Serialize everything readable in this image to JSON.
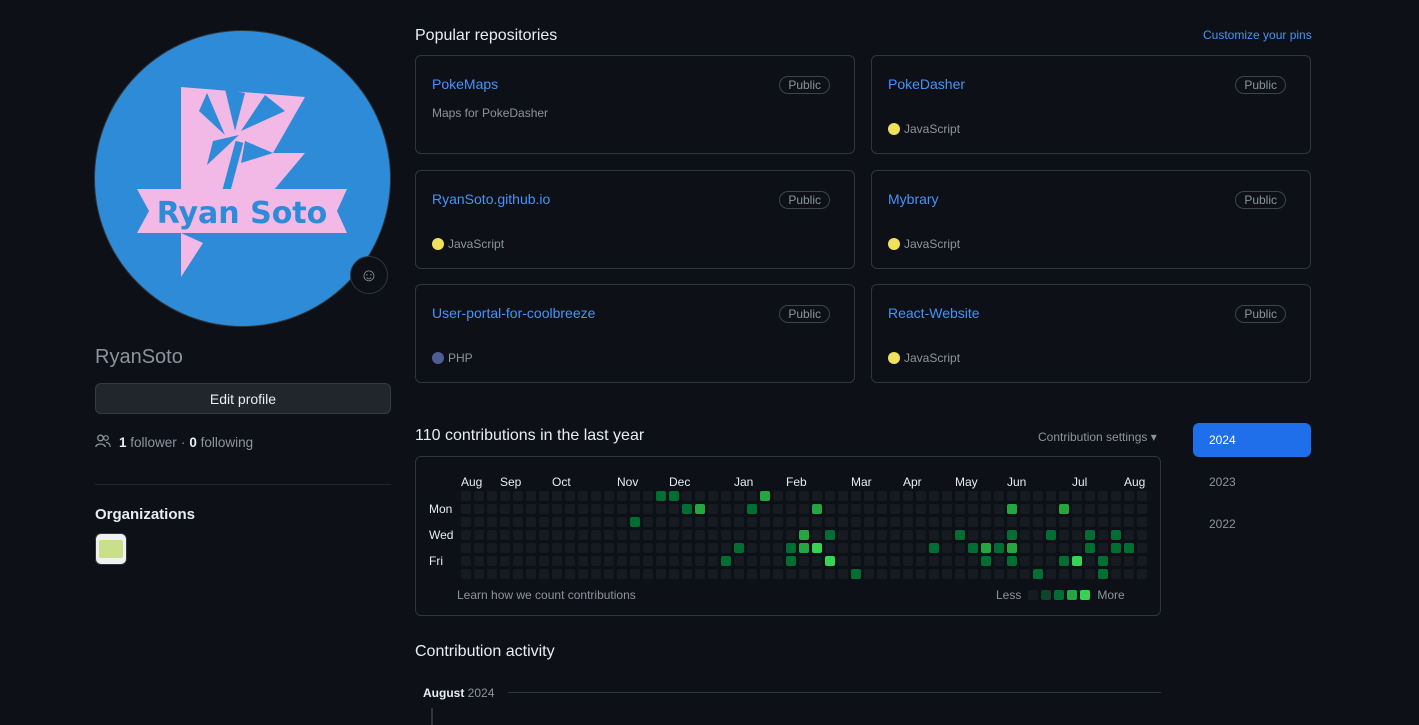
{
  "profile": {
    "avatar_text": "Ryan Soto",
    "username": "RyanSoto",
    "edit_label": "Edit profile",
    "followers_count": "1",
    "followers_label": "follower",
    "following_count": "0",
    "following_label": "following",
    "separator": "·"
  },
  "organizations": {
    "heading": "Organizations"
  },
  "pinned": {
    "title": "Popular repositories",
    "customize_label": "Customize your pins",
    "repos": [
      {
        "name": "PokeMaps",
        "visibility": "Public",
        "description": "Maps for PokeDasher",
        "language": "",
        "lang_color": ""
      },
      {
        "name": "PokeDasher",
        "visibility": "Public",
        "description": "",
        "language": "JavaScript",
        "lang_color": "#f1e05a"
      },
      {
        "name": "RyanSoto.github.io",
        "visibility": "Public",
        "description": "",
        "language": "JavaScript",
        "lang_color": "#f1e05a"
      },
      {
        "name": "Mybrary",
        "visibility": "Public",
        "description": "",
        "language": "JavaScript",
        "lang_color": "#f1e05a"
      },
      {
        "name": "User-portal-for-coolbreeze",
        "visibility": "Public",
        "description": "",
        "language": "PHP",
        "lang_color": "#4F5D95"
      },
      {
        "name": "React-Website",
        "visibility": "Public",
        "description": "",
        "language": "JavaScript",
        "lang_color": "#f1e05a"
      }
    ]
  },
  "contributions": {
    "title": "110 contributions in the last year",
    "settings_label": "Contribution settings ▾",
    "months": [
      "Aug",
      "Sep",
      "Oct",
      "Nov",
      "Dec",
      "Jan",
      "Feb",
      "Mar",
      "Apr",
      "May",
      "Jun",
      "Jul",
      "Aug"
    ],
    "days": [
      "Mon",
      "Wed",
      "Fri"
    ],
    "learn_label": "Learn how we count contributions",
    "less_label": "Less",
    "more_label": "More",
    "colors": [
      "#161b22",
      "#0e4429",
      "#006d32",
      "#26a641",
      "#39d353"
    ],
    "weeks": 53,
    "active_cells": [
      [
        17,
        1,
        2
      ],
      [
        18,
        1,
        3
      ],
      [
        25,
        4,
        2
      ],
      [
        25,
        5,
        2
      ],
      [
        26,
        3,
        3
      ],
      [
        26,
        4,
        3
      ],
      [
        27,
        1,
        3
      ],
      [
        27,
        4,
        4
      ],
      [
        28,
        3,
        2
      ],
      [
        28,
        5,
        4
      ],
      [
        30,
        6,
        2
      ],
      [
        36,
        4,
        2
      ],
      [
        38,
        3,
        2
      ],
      [
        39,
        4,
        2
      ],
      [
        40,
        4,
        3
      ],
      [
        41,
        4,
        2
      ],
      [
        42,
        1,
        3
      ],
      [
        42,
        3,
        2
      ],
      [
        42,
        4,
        3
      ],
      [
        42,
        5,
        2
      ],
      [
        40,
        5,
        2
      ],
      [
        44,
        6,
        2
      ],
      [
        45,
        3,
        2
      ],
      [
        46,
        1,
        3
      ],
      [
        46,
        5,
        2
      ],
      [
        47,
        5,
        4
      ],
      [
        48,
        3,
        2
      ],
      [
        48,
        4,
        2
      ],
      [
        49,
        5,
        2
      ],
      [
        49,
        6,
        2
      ],
      [
        50,
        3,
        2
      ],
      [
        50,
        4,
        2
      ],
      [
        51,
        4,
        2
      ],
      [
        53,
        3,
        2
      ],
      [
        53,
        4,
        3
      ],
      [
        54,
        3,
        3
      ],
      [
        54,
        5,
        2
      ],
      [
        55,
        5,
        2
      ],
      [
        57,
        4,
        2
      ],
      [
        57,
        5,
        2
      ],
      [
        58,
        1,
        3
      ],
      [
        58,
        2,
        3
      ],
      [
        58,
        3,
        3
      ],
      [
        58,
        4,
        2
      ],
      [
        58,
        6,
        2
      ],
      [
        59,
        2,
        3
      ],
      [
        59,
        3,
        3
      ],
      [
        60,
        1,
        2
      ],
      [
        60,
        2,
        4
      ],
      [
        60,
        3,
        4
      ],
      [
        61,
        2,
        3
      ],
      [
        61,
        3,
        3
      ],
      [
        62,
        2,
        2
      ],
      [
        63,
        1,
        3
      ],
      [
        63,
        2,
        2
      ],
      [
        63,
        5,
        2
      ],
      [
        63,
        6,
        3
      ],
      [
        13,
        2,
        2
      ],
      [
        15,
        0,
        2
      ],
      [
        16,
        0,
        2
      ],
      [
        20,
        5,
        2
      ],
      [
        21,
        4,
        2
      ],
      [
        22,
        1,
        2
      ],
      [
        23,
        0,
        3
      ]
    ]
  },
  "years": [
    "2024",
    "2023",
    "2022"
  ],
  "activity": {
    "title": "Contribution activity",
    "month": "August",
    "year": "2024"
  }
}
